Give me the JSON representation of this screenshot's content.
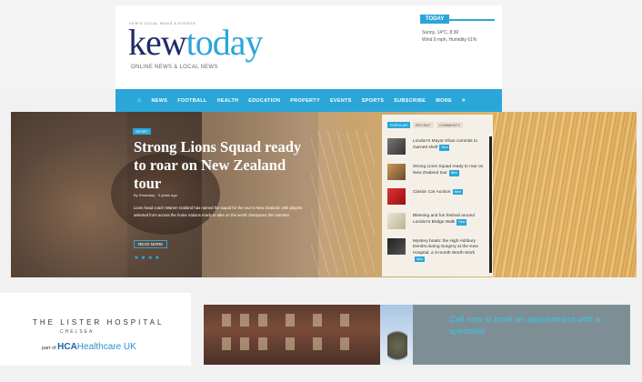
{
  "header": {
    "tagline_top": "KEW'S LOCAL NEWS & EVENTS",
    "logo_kew": "kew",
    "logo_today": "today",
    "logo_sub": "ONLINE NEWS & LOCAL NEWS",
    "today_label": "TODAY",
    "weather_line1": "Sunny, 14°C, 8:30",
    "weather_line2": "Wind 9 mph, Humidity 61%"
  },
  "nav": {
    "items": [
      "NEWS",
      "FOOTBALL",
      "HEALTH",
      "EDUCATION",
      "PROPERTY",
      "EVENTS",
      "SPORTS",
      "SUBSCRIBE",
      "MORE"
    ]
  },
  "hero": {
    "tag": "SPORT",
    "title": "Strong Lions Squad ready to roar on New Zealand tour",
    "meta": "By Kewtoday · 3 years ago",
    "excerpt": "Lions head coach Warren Gatland has named his squad for the tour to New Zealand, with players selected from across the home nations ready to take on the world champions this summer.",
    "button": "READ MORE"
  },
  "widget": {
    "tabs": [
      "POPULAR",
      "RECENT",
      "COMMENTS"
    ],
    "items": [
      {
        "text": "London's Mayor Khan commits to Garnett shelf",
        "badge": "New"
      },
      {
        "text": "Strong Lions Squad ready to roar on New Zealand tour",
        "badge": "New"
      },
      {
        "text": "Classic Car Auction",
        "badge": "New"
      },
      {
        "text": "Blessing and fun festival around London's Bridge Walk",
        "badge": "New"
      },
      {
        "text": "Mystery boats: the High Ashbury Dentist during Surgery at the Kew Hospital, a 3-month Worth Work",
        "badge": "New"
      }
    ]
  },
  "ad": {
    "lister_name": "THE LISTER HOSPITAL",
    "lister_sub": "CHELSEA",
    "part_of": "part of",
    "hca": "HCA",
    "healthcare": "Healthcare UK",
    "cta": "Call now to book an appointment with a specialist"
  }
}
